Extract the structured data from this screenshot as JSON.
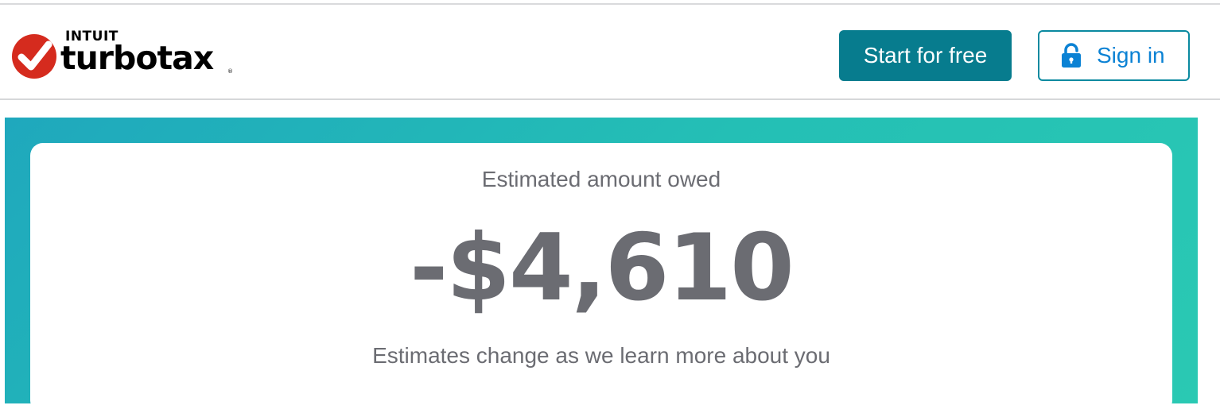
{
  "brand": {
    "intuit": "INTUIT",
    "name": "turbotax",
    "trademark": "®"
  },
  "header": {
    "start_label": "Start for free",
    "signin_label": "Sign in"
  },
  "estimate": {
    "label": "Estimated amount owed",
    "amount": "-$4,610",
    "note": "Estimates change as we learn more about you"
  },
  "colors": {
    "brand_red": "#d52b1e",
    "primary_button": "#077c8e",
    "signin_blue": "#0b82d4",
    "hero_teal": "#24bfb5",
    "text_gray": "#6b6c72"
  },
  "icons": {
    "logo": "red-checkmark-circle-icon",
    "signin": "lock-icon"
  }
}
